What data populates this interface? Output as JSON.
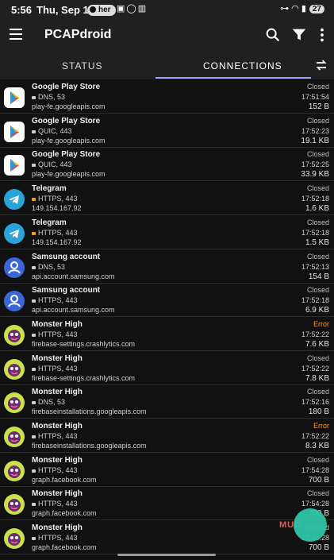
{
  "statusbar": {
    "time": "5:56",
    "date": "Thu, Sep 17",
    "pill": "her",
    "battery": "27"
  },
  "appbar": {
    "title": "PCAPdroid",
    "icons": [
      "menu-icon",
      "search-icon",
      "filter-icon",
      "more-vert-icon"
    ]
  },
  "tabs": {
    "status": "STATUS",
    "connections": "CONNECTIONS"
  },
  "colors": {
    "accent": "#9aa7ff",
    "error": "#f39c33",
    "lock": "#f0a020",
    "fab": "#2ec4a6"
  },
  "rows": [
    {
      "app": "Google Play Store",
      "icon": "play",
      "proto": "DNS, 53",
      "host": "play-fe.googleapis.com",
      "status": "Closed",
      "time": "17:51:54",
      "bytes": "152 B",
      "locked": false
    },
    {
      "app": "Google Play Store",
      "icon": "play",
      "proto": "QUIC, 443",
      "host": "play-fe.googleapis.com",
      "status": "Closed",
      "time": "17:52:23",
      "bytes": "19.1 KB",
      "locked": false
    },
    {
      "app": "Google Play Store",
      "icon": "play",
      "proto": "QUIC, 443",
      "host": "play-fe.googleapis.com",
      "status": "Closed",
      "time": "17:52:25",
      "bytes": "33.9 KB",
      "locked": false
    },
    {
      "app": "Telegram",
      "icon": "telegram",
      "proto": "HTTPS, 443",
      "host": "149.154.167.92",
      "status": "Closed",
      "time": "17:52:18",
      "bytes": "1.6 KB",
      "locked": true
    },
    {
      "app": "Telegram",
      "icon": "telegram",
      "proto": "HTTPS, 443",
      "host": "149.154.167.92",
      "status": "Closed",
      "time": "17:52:18",
      "bytes": "1.5 KB",
      "locked": true
    },
    {
      "app": "Samsung account",
      "icon": "samsung",
      "proto": "DNS, 53",
      "host": "api.account.samsung.com",
      "status": "Closed",
      "time": "17:52:13",
      "bytes": "154 B",
      "locked": false
    },
    {
      "app": "Samsung account",
      "icon": "samsung",
      "proto": "HTTPS, 443",
      "host": "api.account.samsung.com",
      "status": "Closed",
      "time": "17:52:18",
      "bytes": "6.9 KB",
      "locked": false
    },
    {
      "app": "Monster High",
      "icon": "monster",
      "proto": "HTTPS, 443",
      "host": "firebase-settings.crashlytics.com",
      "status": "Error",
      "time": "17:52:22",
      "bytes": "7.6 KB",
      "locked": false
    },
    {
      "app": "Monster High",
      "icon": "monster",
      "proto": "HTTPS, 443",
      "host": "firebase-settings.crashlytics.com",
      "status": "Closed",
      "time": "17:52:22",
      "bytes": "7.8 KB",
      "locked": false
    },
    {
      "app": "Monster High",
      "icon": "monster",
      "proto": "DNS, 53",
      "host": "firebaseinstallations.googleapis.com",
      "status": "Closed",
      "time": "17:52:16",
      "bytes": "180 B",
      "locked": false
    },
    {
      "app": "Monster High",
      "icon": "monster",
      "proto": "HTTPS, 443",
      "host": "firebaseinstallations.googleapis.com",
      "status": "Error",
      "time": "17:52:22",
      "bytes": "8.3 KB",
      "locked": false
    },
    {
      "app": "Monster High",
      "icon": "monster",
      "proto": "HTTPS, 443",
      "host": "graph.facebook.com",
      "status": "Closed",
      "time": "17:54:28",
      "bytes": "700 B",
      "locked": false
    },
    {
      "app": "Monster High",
      "icon": "monster",
      "proto": "HTTPS, 443",
      "host": "graph.facebook.com",
      "status": "Closed",
      "time": "17:54:28",
      "bytes": "700 B",
      "locked": false
    },
    {
      "app": "Monster High",
      "icon": "monster",
      "proto": "HTTPS, 443",
      "host": "graph.facebook.com",
      "status": "Closed",
      "time": "17:54:28",
      "bytes": "700 B",
      "locked": false
    }
  ]
}
